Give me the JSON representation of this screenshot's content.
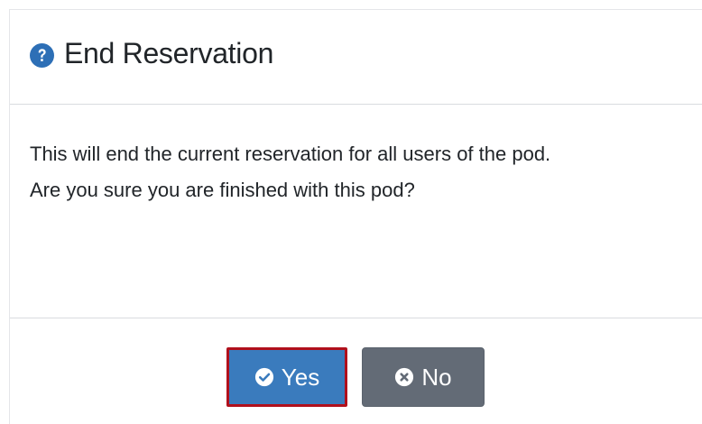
{
  "dialog": {
    "title": "End Reservation",
    "title_icon": "question-circle-icon",
    "message_line1": "This will end the current reservation for all users of the pod.",
    "message_line2": "Are you sure you are finished with this pod?"
  },
  "buttons": {
    "yes_label": "Yes",
    "yes_icon": "check-circle-icon",
    "no_label": "No",
    "no_icon": "times-circle-icon"
  },
  "colors": {
    "primary": "#3a7bbd",
    "secondary": "#636b76",
    "highlight_outline": "#b0101c",
    "title_icon": "#2d6fb6"
  }
}
